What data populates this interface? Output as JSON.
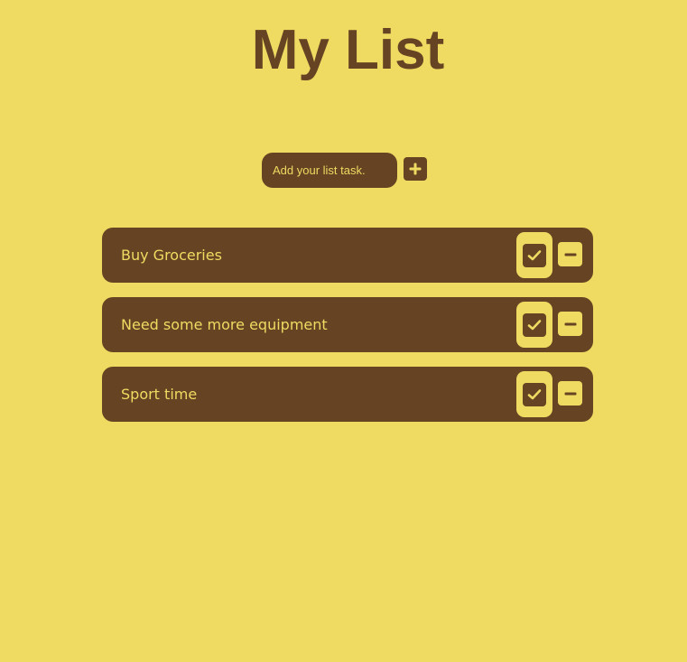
{
  "header": {
    "title": "My List"
  },
  "add_form": {
    "placeholder": "Add your list task.",
    "add_icon": "plus-icon"
  },
  "tasks": [
    {
      "label": "Buy Groceries"
    },
    {
      "label": "Need some more equipment"
    },
    {
      "label": "Sport time"
    }
  ],
  "icons": {
    "complete": "check-icon",
    "remove": "minus-icon"
  },
  "colors": {
    "background": "#efdb62",
    "accent": "#664322"
  }
}
